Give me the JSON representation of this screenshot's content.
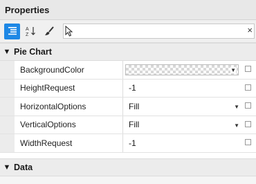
{
  "panel": {
    "title": "Properties"
  },
  "toolbar": {
    "categorized_icon": "categorized-list-icon",
    "alpha_icon": "sort-az-icon",
    "brush_icon": "brush-icon",
    "clear_label": "×"
  },
  "categories": [
    {
      "label": "Pie Chart",
      "rows": [
        {
          "name": "BackgroundColor",
          "value": ""
        },
        {
          "name": "HeightRequest",
          "value": "-1"
        },
        {
          "name": "HorizontalOptions",
          "value": "Fill"
        },
        {
          "name": "VerticalOptions",
          "value": "Fill"
        },
        {
          "name": "WidthRequest",
          "value": "-1"
        }
      ]
    },
    {
      "label": "Data"
    }
  ],
  "colors": {
    "accent": "#1e88e5"
  }
}
